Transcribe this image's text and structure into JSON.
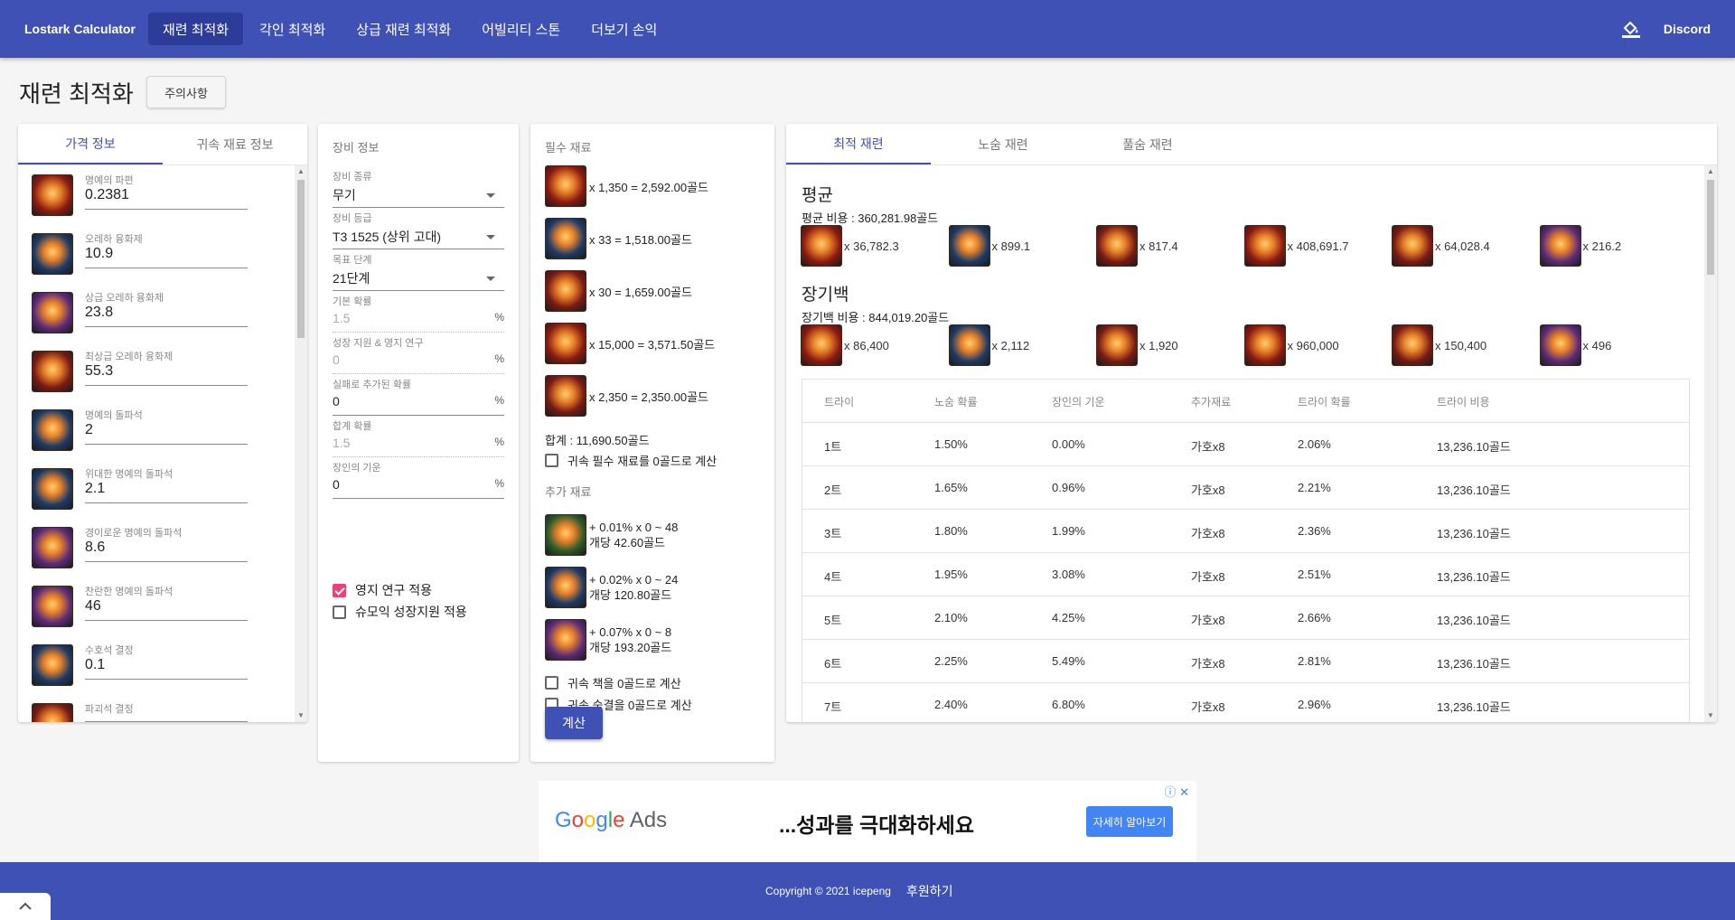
{
  "header": {
    "brand": "Lostark Calculator",
    "nav": [
      "재련 최적화",
      "각인 최적화",
      "상급 재련 최적화",
      "어빌리티 스톤",
      "더보기 손익"
    ],
    "discord": "Discord"
  },
  "page": {
    "title": "재련 최적화",
    "notice_button": "주의사항"
  },
  "prices": {
    "tabs": [
      "가격 정보",
      "귀속 재료 정보"
    ],
    "items": [
      {
        "label": "명예의 파편",
        "value": "0.2381",
        "icon": "honor-shard-icon",
        "color": "#8b1a10"
      },
      {
        "label": "오레하 융화제",
        "value": "10.9",
        "icon": "oreha-fusion-icon",
        "color": "#1d3a66"
      },
      {
        "label": "상급 오레하 융화제",
        "value": "23.8",
        "icon": "superior-oreha-fusion-icon",
        "color": "#5b2a78"
      },
      {
        "label": "최상급 오레하 융화제",
        "value": "55.3",
        "icon": "prime-oreha-fusion-icon",
        "color": "#7a1a14"
      },
      {
        "label": "명예의 돌파석",
        "value": "2",
        "icon": "honor-leapstone-icon",
        "color": "#1d3a66"
      },
      {
        "label": "위대한 명예의 돌파석",
        "value": "2.1",
        "icon": "great-honor-leapstone-icon",
        "color": "#1d3a66"
      },
      {
        "label": "경이로운 명예의 돌파석",
        "value": "8.6",
        "icon": "marvelous-honor-leapstone-icon",
        "color": "#5b2a78"
      },
      {
        "label": "찬란한 명예의 돌파석",
        "value": "46",
        "icon": "radiant-honor-leapstone-icon",
        "color": "#5b2a78"
      },
      {
        "label": "수호석 결정",
        "value": "0.1",
        "icon": "guardian-crystal-icon",
        "color": "#1d3a66"
      },
      {
        "label": "파괴석 결정",
        "value": "",
        "icon": "destruction-crystal-icon",
        "color": "#7a1a14"
      }
    ]
  },
  "equipment": {
    "section_title": "장비 정보",
    "fields": [
      {
        "label": "장비 종류",
        "value": "무기",
        "select": true
      },
      {
        "label": "장비 등급",
        "value": "T3 1525 (상위 고대)",
        "select": true
      },
      {
        "label": "목표 단계",
        "value": "21단계",
        "select": true
      },
      {
        "label": "기본 확률",
        "value": "1.5",
        "suffix": "%",
        "disabled": true
      },
      {
        "label": "성장 지원 & 영지 연구",
        "value": "0",
        "suffix": "%",
        "disabled": true
      },
      {
        "label": "실패로 추가된 확률",
        "value": "0",
        "suffix": "%"
      },
      {
        "label": "합계 확률",
        "value": "1.5",
        "suffix": "%",
        "disabled": true
      },
      {
        "label": "장인의 기운",
        "value": "0",
        "suffix": "%"
      }
    ],
    "checkboxes": [
      {
        "label": "영지 연구 적용",
        "checked": true
      },
      {
        "label": "슈모익 성장지원 적용",
        "checked": false
      }
    ]
  },
  "materials": {
    "required_title": "필수 재료",
    "required": [
      {
        "text": "x 1,350 = 2,592.00골드",
        "icon": "destruction-stone-icon",
        "color": "#8b1a10"
      },
      {
        "text": "x 33 = 1,518.00골드",
        "icon": "honor-leapstone-icon",
        "color": "#1d3a66"
      },
      {
        "text": "x 30 = 1,659.00골드",
        "icon": "oreha-fusion-icon",
        "color": "#7a1a14"
      },
      {
        "text": "x 15,000 = 3,571.50골드",
        "icon": "honor-shard-icon",
        "color": "#8b1a10"
      },
      {
        "text": "x 2,350 = 2,350.00골드",
        "icon": "gold-icon",
        "color": "#7a1a14"
      }
    ],
    "total": "합계 : 11,690.50골드",
    "bound_zero": "귀속 필수 재료를 0골드로 계산",
    "extra_title": "추가 재료",
    "extra": [
      {
        "line1": "+ 0.01% x 0 ~ 48",
        "line2": "개당 42.60골드",
        "icon": "solar-grace-icon",
        "color": "#2c5a2a"
      },
      {
        "line1": "+ 0.02% x 0 ~ 24",
        "line2": "개당 120.80골드",
        "icon": "solar-blessing-icon",
        "color": "#1d3a66"
      },
      {
        "line1": "+ 0.07% x 0 ~ 8",
        "line2": "개당 193.20골드",
        "icon": "solar-protection-icon",
        "color": "#5b2a78"
      }
    ],
    "book_zero": "귀속 책을 0골드로 계산",
    "breath_zero": "귀속 숨결을 0골드로 계산",
    "calc_button": "계산"
  },
  "results": {
    "tabs": [
      "최적 재련",
      "노숨 재련",
      "풀숨 재련"
    ],
    "avg_title": "평균",
    "avg_cost": "평균 비용 : 360,281.98골드",
    "avg_mats": [
      {
        "text": "x 36,782.3",
        "icon": "destruction-stone-icon",
        "color": "#8b1a10"
      },
      {
        "text": "x 899.1",
        "icon": "honor-leapstone-icon",
        "color": "#1d3a66"
      },
      {
        "text": "x 817.4",
        "icon": "oreha-fusion-icon",
        "color": "#7a1a14"
      },
      {
        "text": "x 408,691.7",
        "icon": "honor-shard-icon",
        "color": "#8b1a10"
      },
      {
        "text": "x 64,028.4",
        "icon": "gold-icon",
        "color": "#7a1a14"
      },
      {
        "text": "x 216.2",
        "icon": "solar-protection-icon",
        "color": "#5b2a78"
      }
    ],
    "worst_title": "장기백",
    "worst_cost": "장기백 비용 : 844,019.20골드",
    "worst_mats": [
      {
        "text": "x 86,400",
        "icon": "destruction-stone-icon",
        "color": "#8b1a10"
      },
      {
        "text": "x 2,112",
        "icon": "honor-leapstone-icon",
        "color": "#1d3a66"
      },
      {
        "text": "x 1,920",
        "icon": "oreha-fusion-icon",
        "color": "#7a1a14"
      },
      {
        "text": "x 960,000",
        "icon": "honor-shard-icon",
        "color": "#8b1a10"
      },
      {
        "text": "x 150,400",
        "icon": "gold-icon",
        "color": "#7a1a14"
      },
      {
        "text": "x 496",
        "icon": "solar-protection-icon",
        "color": "#5b2a78"
      }
    ],
    "table_headers": [
      "트라이",
      "노숨 확률",
      "장인의 기운",
      "추가재료",
      "트라이 확률",
      "트라이 비용"
    ],
    "table_rows": [
      [
        "1트",
        "1.50%",
        "0.00%",
        "가호x8",
        "2.06%",
        "13,236.10골드"
      ],
      [
        "2트",
        "1.65%",
        "0.96%",
        "가호x8",
        "2.21%",
        "13,236.10골드"
      ],
      [
        "3트",
        "1.80%",
        "1.99%",
        "가호x8",
        "2.36%",
        "13,236.10골드"
      ],
      [
        "4트",
        "1.95%",
        "3.08%",
        "가호x8",
        "2.51%",
        "13,236.10골드"
      ],
      [
        "5트",
        "2.10%",
        "4.25%",
        "가호x8",
        "2.66%",
        "13,236.10골드"
      ],
      [
        "6트",
        "2.25%",
        "5.49%",
        "가호x8",
        "2.81%",
        "13,236.10골드"
      ],
      [
        "7트",
        "2.40%",
        "6.80%",
        "가호x8",
        "2.96%",
        "13,236.10골드"
      ]
    ]
  },
  "ad": {
    "slogan": "...성과를 극대화하세요",
    "cta": "자세히 알아보기"
  },
  "footer": {
    "copyright": "Copyright © 2021 icepeng",
    "donate": "후원하기"
  },
  "colors": {
    "primary": "#3f51b5",
    "accent": "#ec407a"
  }
}
